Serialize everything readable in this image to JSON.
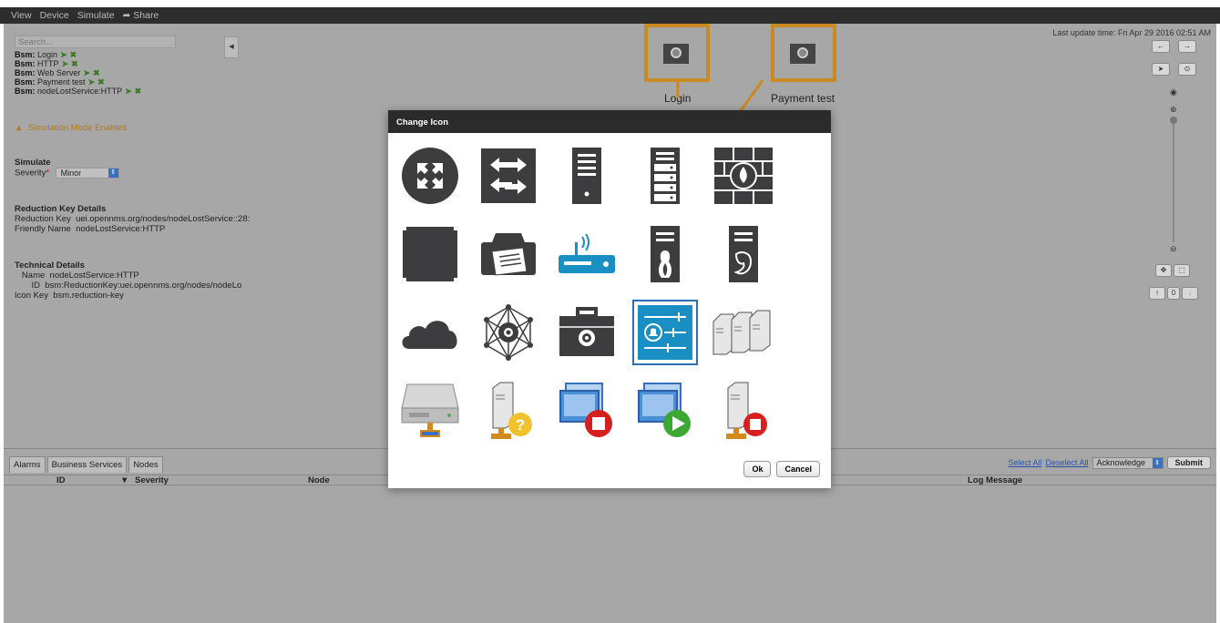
{
  "menu": {
    "items": [
      "View",
      "Device",
      "Simulate"
    ],
    "share": "Share",
    "share_icon": "share-arrow-icon"
  },
  "sidebar": {
    "search_placeholder": "Search...",
    "bsm_prefix": "Bsm:",
    "bsm_items": [
      "Login",
      "HTTP",
      "Web Server",
      "Payment test",
      "nodeLostService:HTTP"
    ],
    "simulation_warning": "Simulation Mode Enabled",
    "simulate_title": "Simulate",
    "severity_label": "Severity",
    "severity_value": "Minor",
    "reduction_title": "Reduction Key Details",
    "reduction_key_label": "Reduction Key",
    "reduction_key_value": "uei.opennms.org/nodes/nodeLostService::28:",
    "friendly_name_label": "Friendly Name",
    "friendly_name_value": "nodeLostService:HTTP",
    "technical_title": "Technical Details",
    "name_label": "Name",
    "name_value": "nodeLostService:HTTP",
    "id_label": "ID",
    "id_value": "bsm:ReductionKey:uei.opennms.org/nodes/nodeLo",
    "icon_key_label": "Icon Key",
    "icon_key_value": "bsm.reduction-key"
  },
  "topology": {
    "nodes": [
      "Login",
      "Payment test"
    ],
    "last_update": "Last update time: Fri Apr 29 2016 02:51 AM",
    "accent": "#c98a22"
  },
  "bottom": {
    "tabs": [
      "Alarms",
      "Business Services",
      "Nodes"
    ],
    "columns": [
      "ID",
      "Severity",
      "Node",
      "Log Message"
    ],
    "select_all": "Select All",
    "deselect_all": "Deselect All",
    "action_value": "Acknowledge",
    "submit": "Submit"
  },
  "modal": {
    "title": "Change Icon",
    "ok": "Ok",
    "cancel": "Cancel",
    "icons": [
      "router-icon",
      "switch-icon",
      "server-icon",
      "rack-server-icon",
      "firewall-icon",
      "generic-device-icon",
      "printer-icon",
      "wireless-router-icon",
      "linux-server-icon",
      "bsd-server-icon",
      "cloud-icon",
      "network-hub-icon",
      "business-service-icon",
      "reduction-key-icon",
      "server-cluster-icon",
      "storage-drive-icon",
      "server-unknown-icon",
      "desktop-stopped-icon",
      "desktop-running-icon",
      "server-stopped-icon"
    ],
    "selected_index": 13
  }
}
